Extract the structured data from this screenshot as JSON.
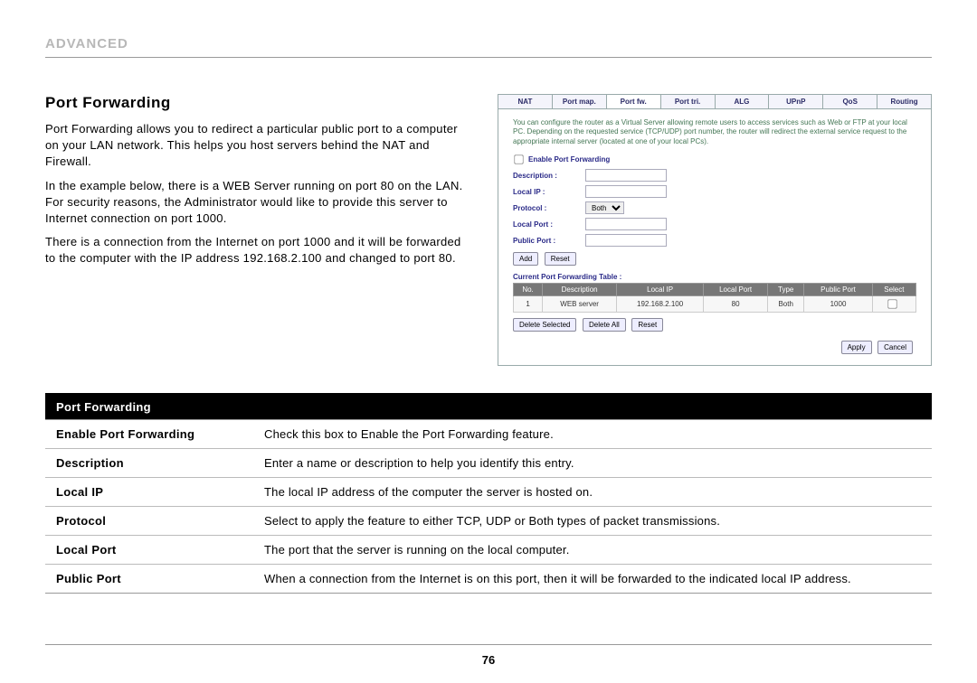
{
  "section_label": "ADVANCED",
  "heading": "Port Forwarding",
  "paragraphs": {
    "p1": "Port Forwarding allows you to redirect a particular public port to a computer on your LAN network. This helps you host servers behind the NAT and Firewall.",
    "p2": "In the example below, there is a WEB Server running on port 80 on the LAN. For security reasons, the Administrator would like to provide this server to Internet connection on port 1000.",
    "p3": "There is a connection from the Internet on port 1000 and  it will be forwarded to the computer with the IP address 192.168.2.100 and changed to port 80."
  },
  "router": {
    "tabs": [
      "NAT",
      "Port map.",
      "Port fw.",
      "Port tri.",
      "ALG",
      "UPnP",
      "QoS",
      "Routing"
    ],
    "active_tab_index": 2,
    "intro": "You can configure the router as a Virtual Server allowing remote users to access services such as Web or FTP at your local PC. Depending on the requested service (TCP/UDP) port number, the router will redirect the external service request to the appropriate internal server (located at one of your local PCs).",
    "enable_label": "Enable Port Forwarding",
    "enable_checked": false,
    "fields": {
      "description": "Description :",
      "local_ip": "Local IP :",
      "protocol": "Protocol :",
      "local_port": "Local Port :",
      "public_port": "Public Port :"
    },
    "protocol_value": "Both",
    "buttons": {
      "add": "Add",
      "reset": "Reset",
      "delete_selected": "Delete Selected",
      "delete_all": "Delete All",
      "reset2": "Reset",
      "apply": "Apply",
      "cancel": "Cancel"
    },
    "table_caption": "Current Port Forwarding Table :",
    "table_headers": [
      "No.",
      "Description",
      "Local IP",
      "Local Port",
      "Type",
      "Public Port",
      "Select"
    ],
    "table_rows": [
      {
        "no": "1",
        "desc": "WEB server",
        "local_ip": "192.168.2.100",
        "local_port": "80",
        "type": "Both",
        "public_port": "1000"
      }
    ]
  },
  "definitions": {
    "header": "Port Forwarding",
    "rows": [
      {
        "key": "Enable Port Forwarding",
        "val": "Check this box to Enable the Port Forwarding feature."
      },
      {
        "key": "Description",
        "val": "Enter a name or description to help you identify this entry."
      },
      {
        "key": "Local IP",
        "val": "The local IP address of the computer the server is hosted on."
      },
      {
        "key": "Protocol",
        "val": "Select to apply the feature to either TCP, UDP or Both types of packet transmissions."
      },
      {
        "key": "Local Port",
        "val": "The port that the server is running on the local computer."
      },
      {
        "key": "Public Port",
        "val": "When a connection from the Internet is on this port, then it will be forwarded to the indicated local IP address."
      }
    ]
  },
  "page_number": "76"
}
